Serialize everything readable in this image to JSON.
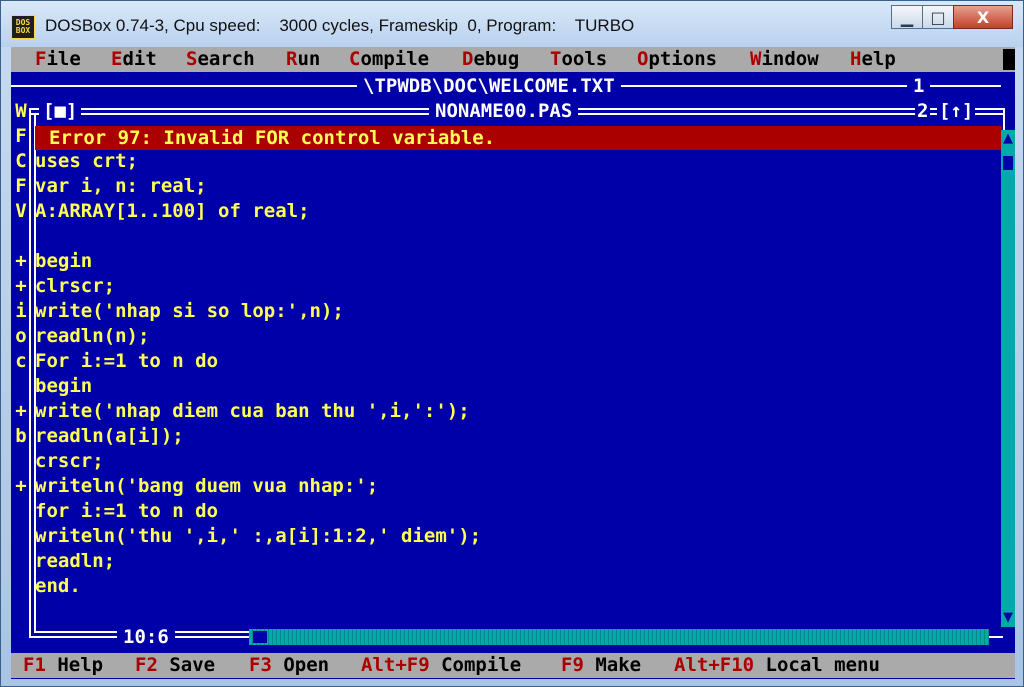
{
  "window": {
    "title": "DOSBox 0.74-3, Cpu speed:    3000 cycles, Frameskip  0, Program:    TURBO",
    "icon_text": "DOS BOX",
    "minimize_glyph": "▁",
    "maximize_glyph": "□",
    "close_glyph": "X"
  },
  "menubar": {
    "items": [
      {
        "hotkey": "F",
        "rest": "ile"
      },
      {
        "hotkey": "E",
        "rest": "dit"
      },
      {
        "hotkey": "S",
        "rest": "earch"
      },
      {
        "hotkey": "R",
        "rest": "un"
      },
      {
        "hotkey": "C",
        "rest": "ompile"
      },
      {
        "hotkey": "D",
        "rest": "ebug"
      },
      {
        "hotkey": "T",
        "rest": "ools"
      },
      {
        "hotkey": "O",
        "rest": "ptions"
      },
      {
        "hotkey": "W",
        "rest": "indow"
      },
      {
        "hotkey": "H",
        "rest": "elp"
      }
    ]
  },
  "back_window": {
    "path": "\\TPWDB\\DOC\\WELCOME.TXT",
    "number": "1",
    "side_chars": [
      "W",
      "F",
      "C",
      "F",
      "V",
      "",
      "+",
      "+",
      "i",
      "o",
      "c",
      "",
      "+",
      "b",
      "",
      "+"
    ]
  },
  "editor": {
    "filename": "NONAME00.PAS",
    "close_box": "[■]",
    "window_number": "2",
    "zoom_box": "[↑]",
    "error": "Error 97: Invalid FOR control variable.",
    "cursor_position": "10:6",
    "code_lines": [
      "uses crt;",
      "var i, n: real;",
      "A:ARRAY[1..100] of real;",
      "",
      "begin",
      "clrscr;",
      "write('nhap si so lop:',n);",
      "readln(n);",
      "For i:=1 to n do",
      "begin",
      "write('nhap diem cua ban thu ',i,':');",
      "readln(a[i]);",
      "crscr;",
      "writeln('bang duem vua nhap:';",
      "for i:=1 to n do",
      "writeln('thu ',i,' :,a[i]:1:2,' diem');",
      "readln;",
      "end."
    ]
  },
  "statusbar": {
    "items": [
      {
        "key": "F1",
        "label": "Help"
      },
      {
        "key": "F2",
        "label": "Save"
      },
      {
        "key": "F3",
        "label": "Open"
      },
      {
        "key": "Alt+F9",
        "label": "Compile"
      },
      {
        "key": "F9",
        "label": "Make"
      },
      {
        "key": "Alt+F10",
        "label": "Local menu"
      }
    ]
  },
  "colors": {
    "background": "#0000a8",
    "text": "#ffff55",
    "menu": "#aaaaaa",
    "hotkey": "#aa0000",
    "error": "#aa0000",
    "scrollbar": "#00aaaa"
  }
}
